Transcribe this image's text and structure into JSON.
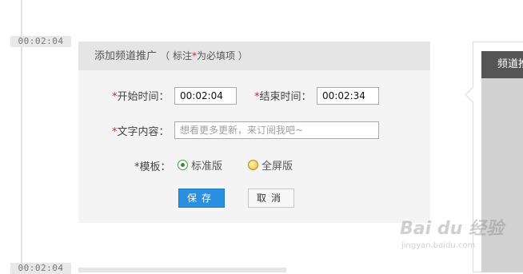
{
  "timeline": {
    "top_time": "00:02:04",
    "bottom_time": "00:02:04"
  },
  "form": {
    "header_title": "添加频道推广",
    "header_note_prefix": "（ 标注",
    "header_note_star": "*",
    "header_note_suffix": "为必填项 ）",
    "start_time": {
      "star": "*",
      "label": "开始时间：",
      "value": "00:02:04"
    },
    "end_time": {
      "star": "*",
      "label": "结束时间：",
      "value": "00:02:34"
    },
    "text_content": {
      "star": "*",
      "label": "文字内容：",
      "placeholder": "想看更多更新，来订阅我吧~"
    },
    "template": {
      "label": "*模板：",
      "options": [
        {
          "label": "标准版",
          "selected": true
        },
        {
          "label": "全屏版",
          "selected": false
        }
      ]
    },
    "save_label": "保存",
    "cancel_label": "取消"
  },
  "preview": {
    "header_text": "频道推"
  },
  "watermark": {
    "main": "Bai du 经验",
    "sub": "jingyan.baidu.com"
  },
  "colors": {
    "required": "#e02020",
    "save_button": "#2b8fe0",
    "preview_header": "#555555"
  },
  "icons": {
    "radio_selected": "radio-checked-icon",
    "radio_unselected": "radio-unchecked-icon"
  }
}
